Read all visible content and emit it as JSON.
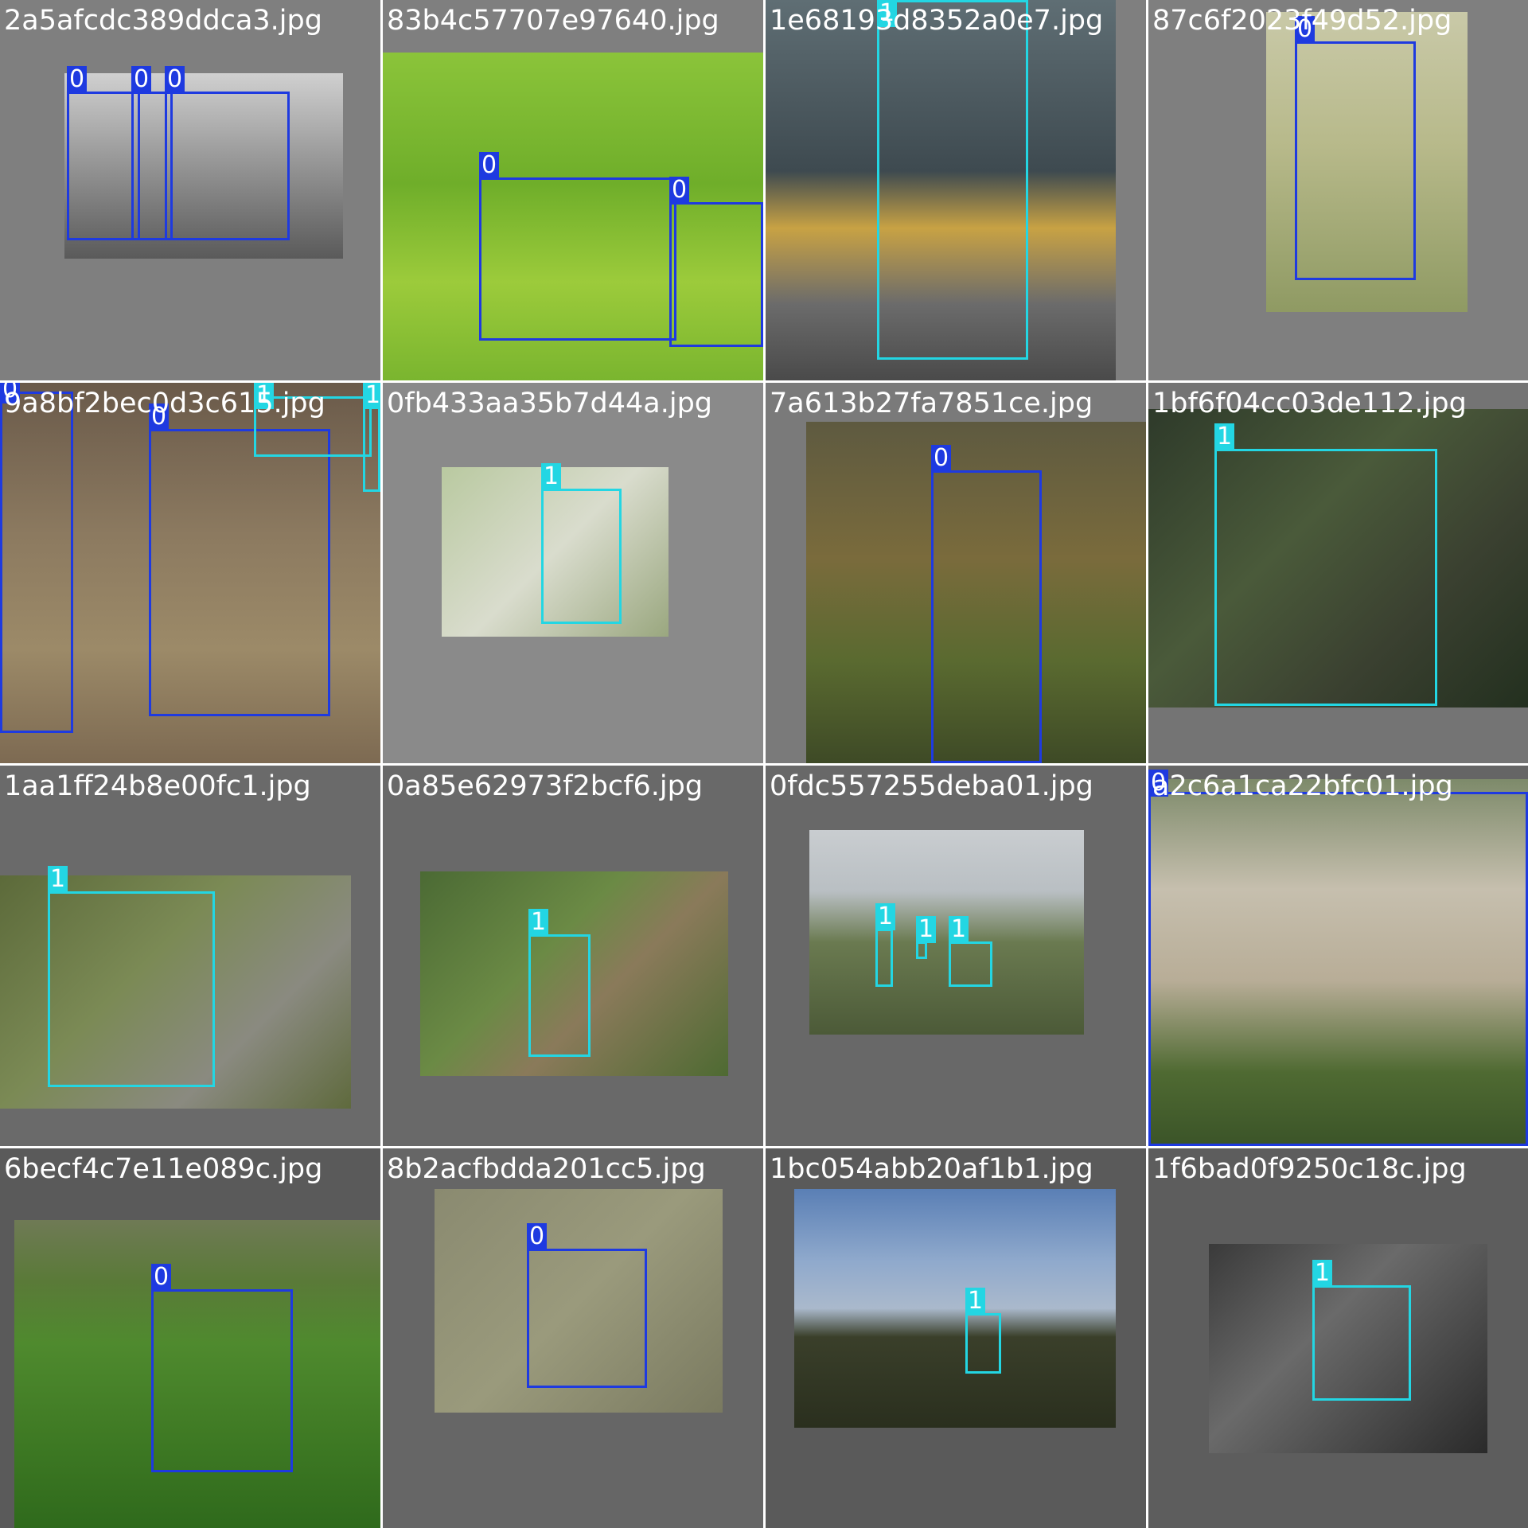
{
  "class_colors": {
    "0": "#1e3ae0",
    "1": "#23d6e3"
  },
  "tiles": [
    {
      "filename": "2a5afcdc389ddca3.jpg",
      "bg": "#7f7f7f",
      "labels": [
        "0",
        "0",
        "0"
      ]
    },
    {
      "filename": "83b4c57707e97640.jpg",
      "bg": "#7f7f7f",
      "labels": [
        "0",
        "0"
      ]
    },
    {
      "filename": "1e68193d8352a0e7.jpg",
      "bg": "#7f7f7f",
      "labels": [
        "1"
      ]
    },
    {
      "filename": "87c6f2023f49d52.jpg",
      "bg": "#7f7f7f",
      "labels": [
        "0"
      ]
    },
    {
      "filename": "9a8bf2bec0d3c615.jpg",
      "bg": "#7f7f7f",
      "labels": [
        "0",
        "0",
        "1",
        "1"
      ]
    },
    {
      "filename": "0fb433aa35b7d44a.jpg",
      "bg": "#8a8a8a",
      "labels": [
        "1"
      ]
    },
    {
      "filename": "7a613b27fa7851ce.jpg",
      "bg": "#7a7a7a",
      "labels": [
        "0"
      ]
    },
    {
      "filename": "1bf6f04cc03de112.jpg",
      "bg": "#747474",
      "labels": [
        "1"
      ]
    },
    {
      "filename": "1aa1ff24b8e00fc1.jpg",
      "bg": "#6a6a6a",
      "labels": [
        "1"
      ]
    },
    {
      "filename": "0a85e62973f2bcf6.jpg",
      "bg": "#696969",
      "labels": [
        "1"
      ]
    },
    {
      "filename": "0fdc557255deba01.jpg",
      "bg": "#686868",
      "labels": [
        "1",
        "1",
        "1"
      ]
    },
    {
      "filename": "a2c6a1ca22bfc01.jpg",
      "bg": "#656565",
      "labels": [
        "0"
      ]
    },
    {
      "filename": "6becf4c7e11e089c.jpg",
      "bg": "#5a5a5a",
      "labels": [
        "0"
      ]
    },
    {
      "filename": "8b2acfbdda201cc5.jpg",
      "bg": "#666666",
      "labels": [
        "0"
      ]
    },
    {
      "filename": "1bc054abb20af1b1.jpg",
      "bg": "#5a5a5a",
      "labels": [
        "1"
      ]
    },
    {
      "filename": "1f6bad0f9250c18c.jpg",
      "bg": "#5d5d5d",
      "labels": [
        "1"
      ]
    }
  ]
}
